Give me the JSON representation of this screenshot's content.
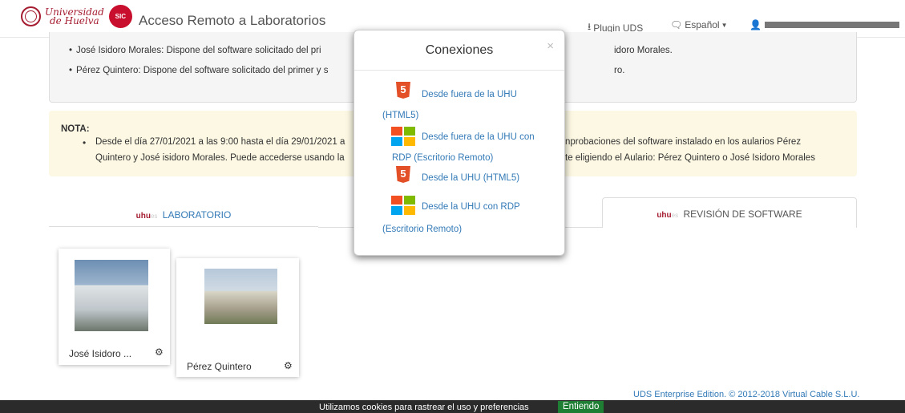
{
  "navbar": {
    "logo_text_1": "Universidad",
    "logo_text_2": "de Huelva",
    "sic_text": "SIC",
    "brand": "Acceso Remoto a Laboratorios",
    "plugin_label": "Plugin UDS",
    "language_label": "Español"
  },
  "info_panel": {
    "items": [
      "José Isidoro Morales:  Dispone del software solicitado del pri",
      "Pérez Quintero: Dispone del software solicitado del primer y s"
    ],
    "item_tails": [
      "idoro Morales.",
      "ro."
    ]
  },
  "note": {
    "title": "NOTA",
    "line1_left": "Desde el día 27/01/2021 a las 9:00 hasta el día 29/01/2021 a",
    "line1_right": "nprobaciones del software instalado en los aularios Pérez",
    "line2_left": "Quintero y José isidoro Morales. Puede accederse usando la",
    "line2_right": "te eligiendo el Aulario: Pérez Quintero o José Isidoro Morales"
  },
  "tabs": [
    {
      "brand": "uhu",
      "brand_sub": "es",
      "label": "LABORATORIO"
    },
    {
      "brand": "uhu",
      "brand_sub": "es",
      "label": "REVISIÓN DE SOFTWARE"
    }
  ],
  "cards": [
    {
      "name": "José Isidoro ...",
      "icon": "gear-icon"
    },
    {
      "name": "Pérez Quintero",
      "icon": "gear-icon"
    }
  ],
  "modal": {
    "title": "Conexiones",
    "close": "×",
    "connections": [
      {
        "icon": "html5-icon",
        "line1": "Desde fuera de la UHU",
        "line2": "(HTML5)"
      },
      {
        "icon": "windows-icon",
        "line1": "Desde fuera de la UHU con",
        "line2": "RDP (Escritorio Remoto)"
      },
      {
        "icon": "html5-icon",
        "line1": "Desde la UHU (HTML5)",
        "line2": ""
      },
      {
        "icon": "windows-icon",
        "line1": "Desde la UHU con RDP",
        "line2": "(Escritorio Remoto)"
      }
    ]
  },
  "footer": {
    "text": "UDS Enterprise Edition. © 2012-2018 Virtual Cable S.L.U."
  },
  "cookie": {
    "text": "Utilizamos cookies para rastrear el uso y preferencias",
    "button": "Entiendo"
  },
  "colors": {
    "brand_red": "#a51c30",
    "link_blue": "#337ab7",
    "note_bg": "#fcf8e3",
    "html5_orange": "#e34f26",
    "win_red": "#f25022",
    "win_green": "#7fba00",
    "win_blue": "#00a4ef",
    "win_yellow": "#ffb900",
    "cookie_button": "#1e7e34"
  }
}
